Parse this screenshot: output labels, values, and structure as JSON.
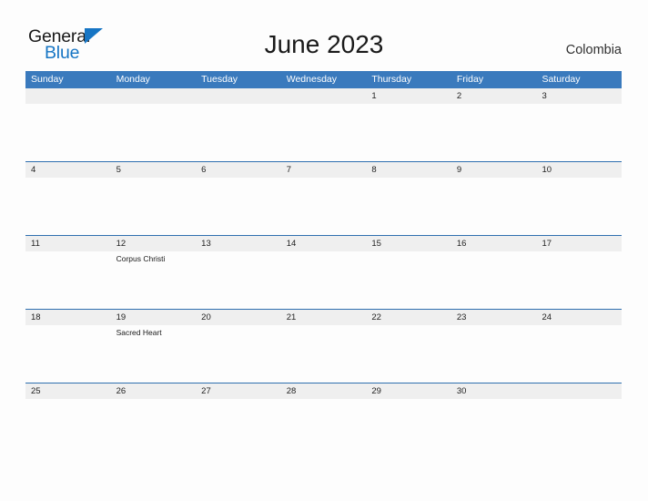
{
  "brand": {
    "name_part1": "General",
    "name_part2": "Blue",
    "logo_icon": "triangle-icon",
    "color_black": "#1a1a1a",
    "color_blue": "#1675c4"
  },
  "header": {
    "title": "June 2023",
    "country": "Colombia"
  },
  "colors": {
    "header_bar": "#3a7abd",
    "row_divider": "#2f6faf",
    "date_band": "#efefef",
    "cell_body": "#fdfdfd",
    "page_background": "#fdfdfd"
  },
  "calendar": {
    "month": "June",
    "year": "2023",
    "weekday_headers": [
      "Sunday",
      "Monday",
      "Tuesday",
      "Wednesday",
      "Thursday",
      "Friday",
      "Saturday"
    ],
    "weeks": [
      {
        "days": [
          {
            "number": "",
            "events": []
          },
          {
            "number": "",
            "events": []
          },
          {
            "number": "",
            "events": []
          },
          {
            "number": "",
            "events": []
          },
          {
            "number": "1",
            "events": []
          },
          {
            "number": "2",
            "events": []
          },
          {
            "number": "3",
            "events": []
          }
        ]
      },
      {
        "days": [
          {
            "number": "4",
            "events": []
          },
          {
            "number": "5",
            "events": []
          },
          {
            "number": "6",
            "events": []
          },
          {
            "number": "7",
            "events": []
          },
          {
            "number": "8",
            "events": []
          },
          {
            "number": "9",
            "events": []
          },
          {
            "number": "10",
            "events": []
          }
        ]
      },
      {
        "days": [
          {
            "number": "11",
            "events": []
          },
          {
            "number": "12",
            "events": [
              "Corpus Christi"
            ]
          },
          {
            "number": "13",
            "events": []
          },
          {
            "number": "14",
            "events": []
          },
          {
            "number": "15",
            "events": []
          },
          {
            "number": "16",
            "events": []
          },
          {
            "number": "17",
            "events": []
          }
        ]
      },
      {
        "days": [
          {
            "number": "18",
            "events": []
          },
          {
            "number": "19",
            "events": [
              "Sacred Heart"
            ]
          },
          {
            "number": "20",
            "events": []
          },
          {
            "number": "21",
            "events": []
          },
          {
            "number": "22",
            "events": []
          },
          {
            "number": "23",
            "events": []
          },
          {
            "number": "24",
            "events": []
          }
        ]
      },
      {
        "days": [
          {
            "number": "25",
            "events": []
          },
          {
            "number": "26",
            "events": []
          },
          {
            "number": "27",
            "events": []
          },
          {
            "number": "28",
            "events": []
          },
          {
            "number": "29",
            "events": []
          },
          {
            "number": "30",
            "events": []
          },
          {
            "number": "",
            "events": []
          }
        ]
      }
    ]
  }
}
